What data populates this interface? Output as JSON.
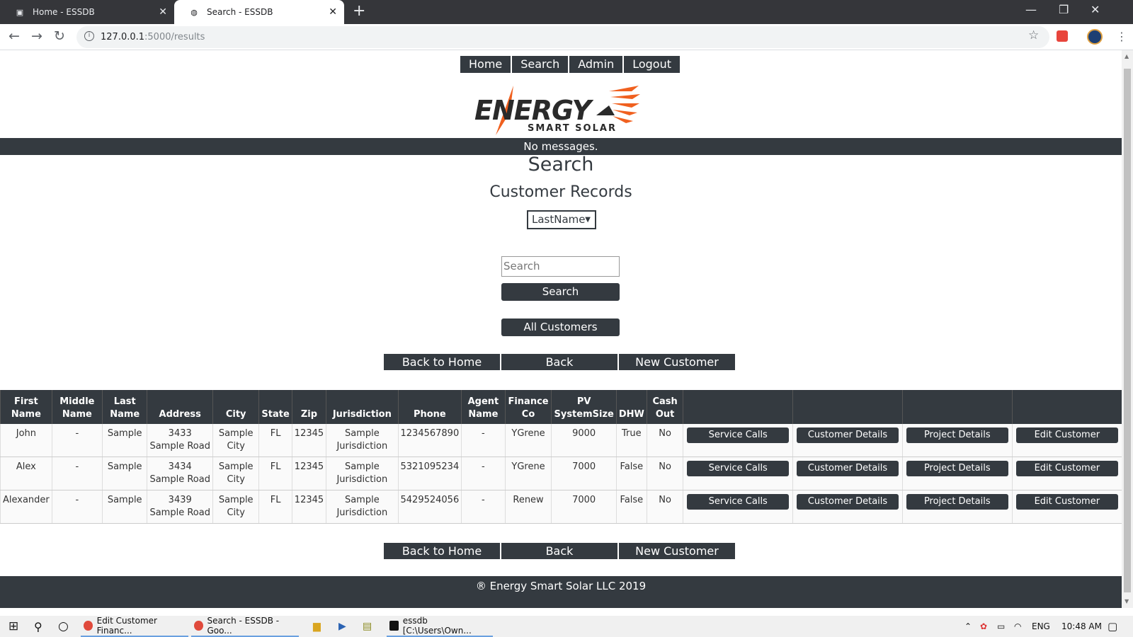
{
  "browser": {
    "tabs": [
      {
        "title": "Home - ESSDB",
        "active": false
      },
      {
        "title": "Search - ESSDB",
        "active": true
      }
    ],
    "url_host": "127.0.0.1",
    "url_path": ":5000/results"
  },
  "nav": [
    "Home",
    "Search",
    "Admin",
    "Logout"
  ],
  "logo": {
    "word": "ENERGY",
    "tagline": "SMART SOLAR"
  },
  "message": "No messages.",
  "heading": "Search",
  "subheading": "Customer Records",
  "search_field": {
    "selected": "LastName",
    "placeholder": "Search"
  },
  "buttons": {
    "search": "Search",
    "all_customers": "All Customers",
    "back_home": "Back to Home",
    "back": "Back",
    "new_customer": "New Customer"
  },
  "table": {
    "columns": [
      [
        "First",
        "Name"
      ],
      [
        "Middle",
        "Name"
      ],
      [
        "Last",
        "Name"
      ],
      [
        "",
        "Address"
      ],
      [
        "",
        "City"
      ],
      [
        "",
        "State"
      ],
      [
        "",
        "Zip"
      ],
      [
        "",
        "Jurisdiction"
      ],
      [
        "",
        "Phone"
      ],
      [
        "Agent",
        "Name"
      ],
      [
        "Finance",
        "Co"
      ],
      [
        "PV",
        "SystemSize"
      ],
      [
        "",
        "DHW"
      ],
      [
        "Cash",
        "Out"
      ]
    ],
    "actions": [
      "Service Calls",
      "Customer Details",
      "Project Details",
      "Edit Customer"
    ],
    "rows": [
      [
        "John",
        "-",
        "Sample",
        "3433 Sample Road",
        "Sample City",
        "FL",
        "12345",
        "Sample Jurisdiction",
        "1234567890",
        "-",
        "YGrene",
        "9000",
        "True",
        "No"
      ],
      [
        "Alex",
        "-",
        "Sample",
        "3434 Sample Road",
        "Sample City",
        "FL",
        "12345",
        "Sample Jurisdiction",
        "5321095234",
        "-",
        "YGrene",
        "7000",
        "False",
        "No"
      ],
      [
        "Alexander",
        "-",
        "Sample",
        "3439 Sample Road",
        "Sample City",
        "FL",
        "12345",
        "Sample Jurisdiction",
        "5429524056",
        "-",
        "Renew",
        "7000",
        "False",
        "No"
      ]
    ]
  },
  "footer": "® Energy Smart Solar LLC 2019",
  "taskbar": {
    "items": [
      "Edit Customer Financ...",
      "Search - ESSDB - Goo...",
      "essdb [C:\\Users\\Own..."
    ],
    "lang": "ENG",
    "time": "10:48 AM"
  },
  "colors": {
    "dark": "#343a40",
    "chrome": "#35363a",
    "logo_orange": "#f0601f"
  }
}
